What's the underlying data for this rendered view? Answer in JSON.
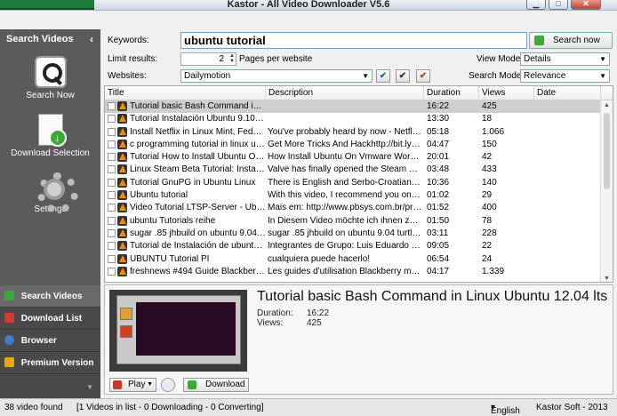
{
  "window": {
    "title": "Kastor - All Video Downloader V5.6"
  },
  "sidebar": {
    "header": "Search Videos",
    "actions": [
      {
        "label": "Search Now"
      },
      {
        "label": "Download Selection"
      },
      {
        "label": "Settings"
      }
    ],
    "nav": [
      {
        "label": "Search Videos",
        "icon_color": "#3aaa35"
      },
      {
        "label": "Download List",
        "icon_color": "#d63a2f"
      },
      {
        "label": "Browser",
        "icon_color": "#3a7bd5"
      },
      {
        "label": "Premium Version",
        "icon_color": "#e8a317"
      }
    ]
  },
  "search": {
    "keywords_label": "Keywords:",
    "keywords_value": "ubuntu tutorial",
    "search_button": "Search now",
    "limit_label": "Limit results:",
    "limit_value": "2",
    "limit_suffix": "Pages per website",
    "websites_label": "Websites:",
    "website_value": "Dailymotion",
    "view_mode_label": "View Mode:",
    "view_mode_value": "Details",
    "search_mode_label": "Search Mode:",
    "search_mode_value": "Relevance"
  },
  "table": {
    "columns": [
      "Title",
      "Description",
      "Duration",
      "Views",
      "Date"
    ],
    "rows": [
      {
        "title": "Tutorial basic Bash Command in Linu...",
        "description": "",
        "duration": "16:22",
        "views": "425"
      },
      {
        "title": "Tutorial Instalación Ubuntu 9.10 a tr...",
        "description": "",
        "duration": "13:30",
        "views": "18"
      },
      {
        "title": "Install Netflix in Linux Mint, Fedora a...",
        "description": "You've probably heard by now - Netflix wor...",
        "duration": "05:18",
        "views": "1.066"
      },
      {
        "title": "c programming tutorial in linux ubuntu",
        "description": "Get More Tricks And Hackhttp://bit.ly/NdJV...",
        "duration": "04:47",
        "views": "150"
      },
      {
        "title": "Tutorial How  to Install Ubuntu On V...",
        "description": "How Install Ubuntu On Vmware Workstatio...",
        "duration": "20:01",
        "views": "42"
      },
      {
        "title": "Linux Steam Beta Tutorial: Installing ...",
        "description": "Valve has finally opened the Steam beta fo...",
        "duration": "03:48",
        "views": "433"
      },
      {
        "title": "Tutorial  GnuPG in Ubuntu Linux",
        "description": "There is English and Serbo-Croatian subtitle...",
        "duration": "10:36",
        "views": "140"
      },
      {
        "title": "Ubuntu tutorial",
        "description": "With this video, I recommend you one of th...",
        "duration": "01:02",
        "views": "29"
      },
      {
        "title": "Video Tutorial LTSP-Server - Ubuntu ...",
        "description": "Mais em: http://www.pbsys.com.br/produc...",
        "duration": "01:52",
        "views": "400"
      },
      {
        "title": "ubuntu Tutorials reihe",
        "description": "In Diesem Video möchte ich ihnen zeigen wi...",
        "duration": "01:50",
        "views": "78"
      },
      {
        "title": "sugar .85 jhbuild on ubuntu 9.04 tur...",
        "description": "sugar .85 jhbuild on ubuntu 9.04 turtle art ...",
        "duration": "03:11",
        "views": "228"
      },
      {
        "title": "Tutorial de Instalación de ubuntu 11...",
        "description": "Integrantes de Grupo: Luis Eduardo Barrer...",
        "duration": "09:05",
        "views": "22"
      },
      {
        "title": "UBUNTU Tutorial PI",
        "description": "cualquiera puede hacerlo!",
        "duration": "06:54",
        "views": "24"
      },
      {
        "title": "freshnews #494 Guide Blackberry m...",
        "description": "Les guides d'utilisation Blackberry messeng...",
        "duration": "04:17",
        "views": "1.339"
      }
    ]
  },
  "preview": {
    "title": "Tutorial basic Bash Command in Linux Ubuntu 12.04 lts",
    "duration_label": "Duration:",
    "duration_value": "16:22",
    "views_label": "Views:",
    "views_value": "425",
    "play_button": "Play",
    "download_button": "Download"
  },
  "status": {
    "found": "38 video found",
    "summary": "[1 Videos in list - 0 Downloading - 0 Converting]",
    "language": "English",
    "copyright": "Kastor Soft - 2013"
  }
}
